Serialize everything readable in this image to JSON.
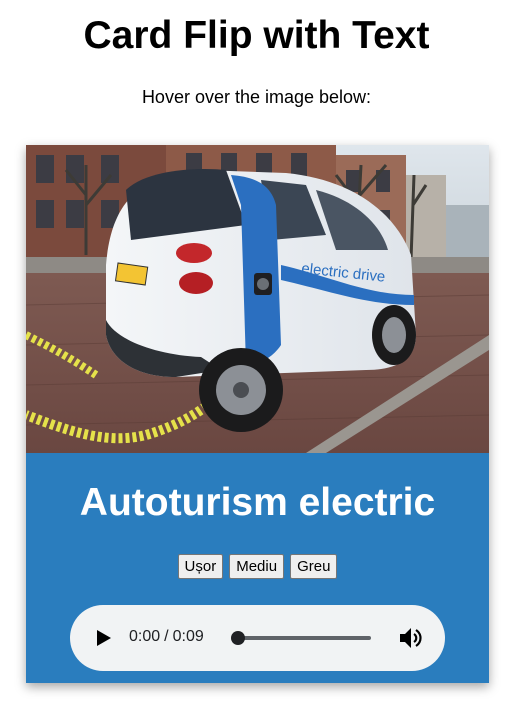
{
  "header": {
    "title": "Card Flip with Text",
    "subtitle": "Hover over the image below:"
  },
  "card": {
    "image_alt": "Blue and white electric car charging at a street station",
    "car_decal": "electric drive",
    "plate": "HP-05",
    "title": "Autoturism electric",
    "background_color": "#2a7dbe",
    "difficulty_buttons": [
      "Ușor",
      "Mediu",
      "Greu"
    ]
  },
  "audio": {
    "current_time": "0:00",
    "separator": "/",
    "duration": "0:09",
    "progress": 0,
    "play_icon": "play-icon",
    "volume_icon": "volume-icon"
  }
}
